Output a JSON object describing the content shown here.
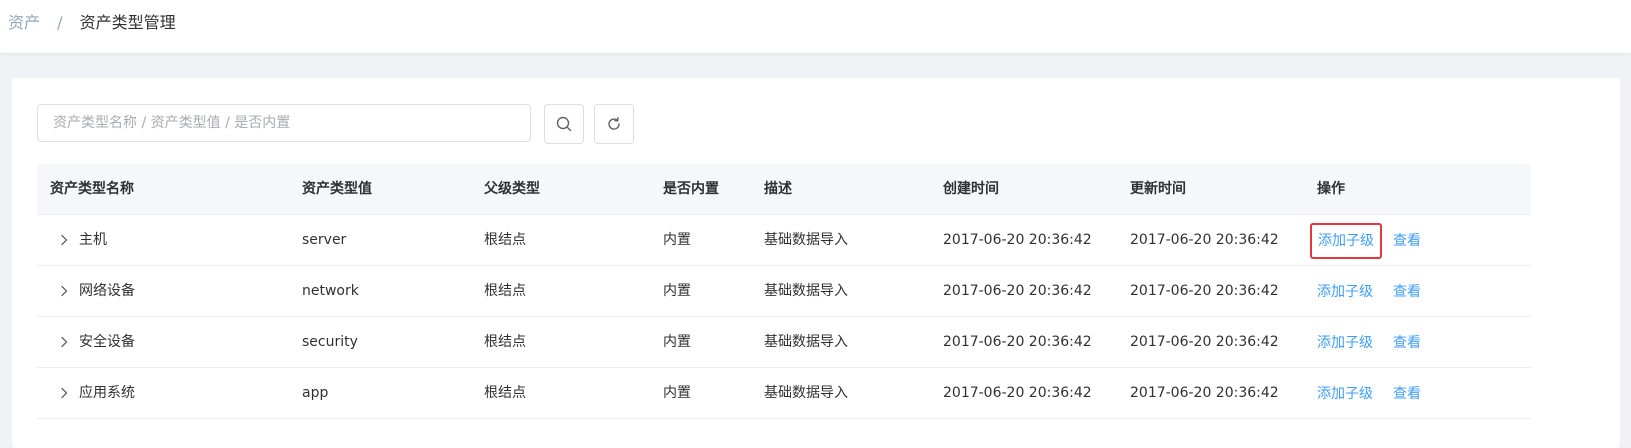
{
  "breadcrumb": {
    "parent": "资产",
    "separator": "/",
    "current": "资产类型管理"
  },
  "search": {
    "placeholder": "资产类型名称 / 资产类型值 / 是否内置",
    "value": ""
  },
  "icons": {
    "search": "search-icon",
    "refresh": "refresh-icon",
    "expand": "chevron-right-icon"
  },
  "colors": {
    "link": "#409eff",
    "highlight_border": "#e0393e",
    "header_bg": "#f5f7fa"
  },
  "table": {
    "columns": [
      "资产类型名称",
      "资产类型值",
      "父级类型",
      "是否内置",
      "描述",
      "创建时间",
      "更新时间",
      "操作"
    ],
    "rows": [
      {
        "name": "主机",
        "value": "server",
        "parent": "根结点",
        "builtin": "内置",
        "desc": "基础数据导入",
        "created": "2017-06-20 20:36:42",
        "updated": "2017-06-20 20:36:42",
        "add_label": "添加子级",
        "view_label": "查看"
      },
      {
        "name": "网络设备",
        "value": "network",
        "parent": "根结点",
        "builtin": "内置",
        "desc": "基础数据导入",
        "created": "2017-06-20 20:36:42",
        "updated": "2017-06-20 20:36:42",
        "add_label": "添加子级",
        "view_label": "查看"
      },
      {
        "name": "安全设备",
        "value": "security",
        "parent": "根结点",
        "builtin": "内置",
        "desc": "基础数据导入",
        "created": "2017-06-20 20:36:42",
        "updated": "2017-06-20 20:36:42",
        "add_label": "添加子级",
        "view_label": "查看"
      },
      {
        "name": "应用系统",
        "value": "app",
        "parent": "根结点",
        "builtin": "内置",
        "desc": "基础数据导入",
        "created": "2017-06-20 20:36:42",
        "updated": "2017-06-20 20:36:42",
        "add_label": "添加子级",
        "view_label": "查看"
      }
    ]
  }
}
